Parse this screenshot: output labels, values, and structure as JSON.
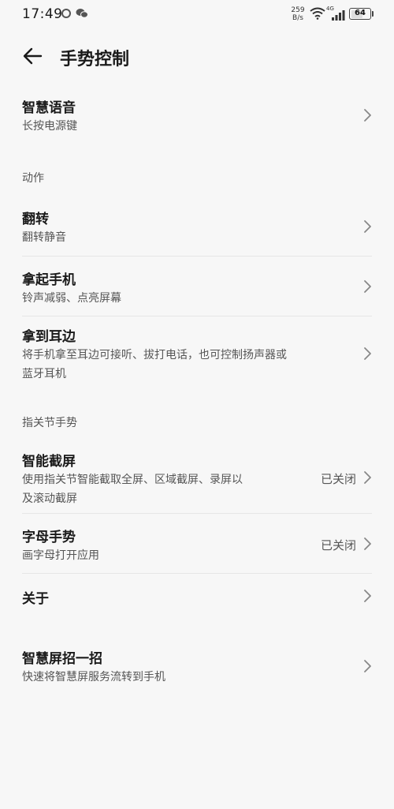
{
  "status_bar": {
    "time": "17:49",
    "net_speed_value": "259",
    "net_speed_unit": "B/s",
    "network_type": "4G",
    "battery": "64",
    "battery_level": 0.64
  },
  "header": {
    "title": "手势控制"
  },
  "smart_voice": {
    "title": "智慧语音",
    "subtitle": "长按电源键"
  },
  "actions": {
    "section_label": "动作",
    "items": [
      {
        "title": "翻转",
        "subtitle": "翻转静音"
      },
      {
        "title": "拿起手机",
        "subtitle": "铃声减弱、点亮屏幕"
      },
      {
        "title": "拿到耳边",
        "subtitle_line1": "将手机拿至耳边可接听、拔打电话，也可控制扬声器或",
        "subtitle_line2": "蓝牙耳机"
      }
    ]
  },
  "knuckle": {
    "section_label": "指关节手势",
    "items": [
      {
        "title": "智能截屏",
        "subtitle_line1": "使用指关节智能截取全屏、区域截屏、录屏以",
        "subtitle_line2": "及滚动截屏",
        "status": "已关闭"
      },
      {
        "title": "字母手势",
        "subtitle": "画字母打开应用",
        "status": "已关闭"
      },
      {
        "title": "关于"
      }
    ]
  },
  "smart_screen": {
    "title": "智慧屏招一招",
    "subtitle": "快速将智慧屏服务流转到手机"
  }
}
